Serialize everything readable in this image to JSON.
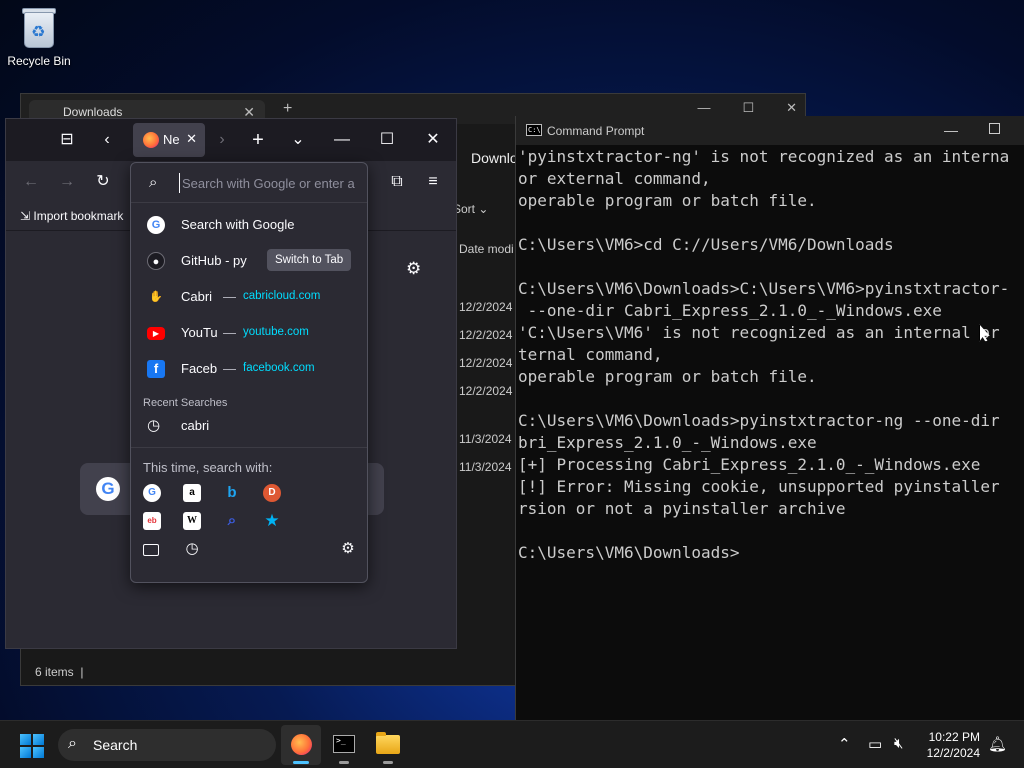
{
  "desktop": {
    "recycle_bin_label": "Recycle Bin"
  },
  "explorer": {
    "tab_label": "Downloads",
    "address_fragment": "Downlo",
    "sort_label": "Sort",
    "date_header": "Date modi",
    "dates": [
      "12/2/2024",
      "12/2/2024",
      "12/2/2024",
      "12/2/2024",
      "11/3/2024",
      "11/3/2024"
    ],
    "status_items": "6 items"
  },
  "firefox": {
    "tab_label": "Ne",
    "import_bookmarks": "Import bookmark",
    "urlbar": {
      "placeholder": "Search with Google or enter a",
      "results": [
        {
          "title": "Search with Google",
          "url": "",
          "icon": "google-icon"
        },
        {
          "title": "GitHub - py",
          "url": "",
          "icon": "github-icon",
          "action": "Switch to Tab"
        },
        {
          "title": "Cabri",
          "url": "cabricloud.com",
          "icon": "cabri-icon"
        },
        {
          "title": "YouTu",
          "url": "youtube.com",
          "icon": "youtube-icon"
        },
        {
          "title": "Faceb",
          "url": "facebook.com",
          "icon": "facebook-icon"
        }
      ],
      "recent_label": "Recent Searches",
      "recent_items": [
        "cabri"
      ],
      "this_time_label": "This time, search with:",
      "dash": "—"
    }
  },
  "cmd": {
    "title": "Command Prompt",
    "lines": [
      "'pyinstxtractor-ng' is not recognized as an interna",
      "or external command,",
      "operable program or batch file.",
      "",
      "C:\\Users\\VM6>cd C://Users/VM6/Downloads",
      "",
      "C:\\Users\\VM6\\Downloads>C:\\Users\\VM6>pyinstxtractor-",
      " --one-dir Cabri_Express_2.1.0_-_Windows.exe",
      "'C:\\Users\\VM6' is not recognized as an internal or",
      "ternal command,",
      "operable program or batch file.",
      "",
      "C:\\Users\\VM6\\Downloads>pyinstxtractor-ng --one-dir",
      "bri_Express_2.1.0_-_Windows.exe",
      "[+] Processing Cabri_Express_2.1.0_-_Windows.exe",
      "[!] Error: Missing cookie, unsupported pyinstaller",
      "rsion or not a pyinstaller archive",
      "",
      "C:\\Users\\VM6\\Downloads>"
    ]
  },
  "taskbar": {
    "search_label": "Search",
    "time": "10:22 PM",
    "date": "12/2/2024"
  },
  "colors": {
    "firefox_bg": "#2b2a33",
    "url_accent": "#00ddff",
    "cmd_text": "#cccccc",
    "taskbar_bg": "#1c1c1c"
  }
}
